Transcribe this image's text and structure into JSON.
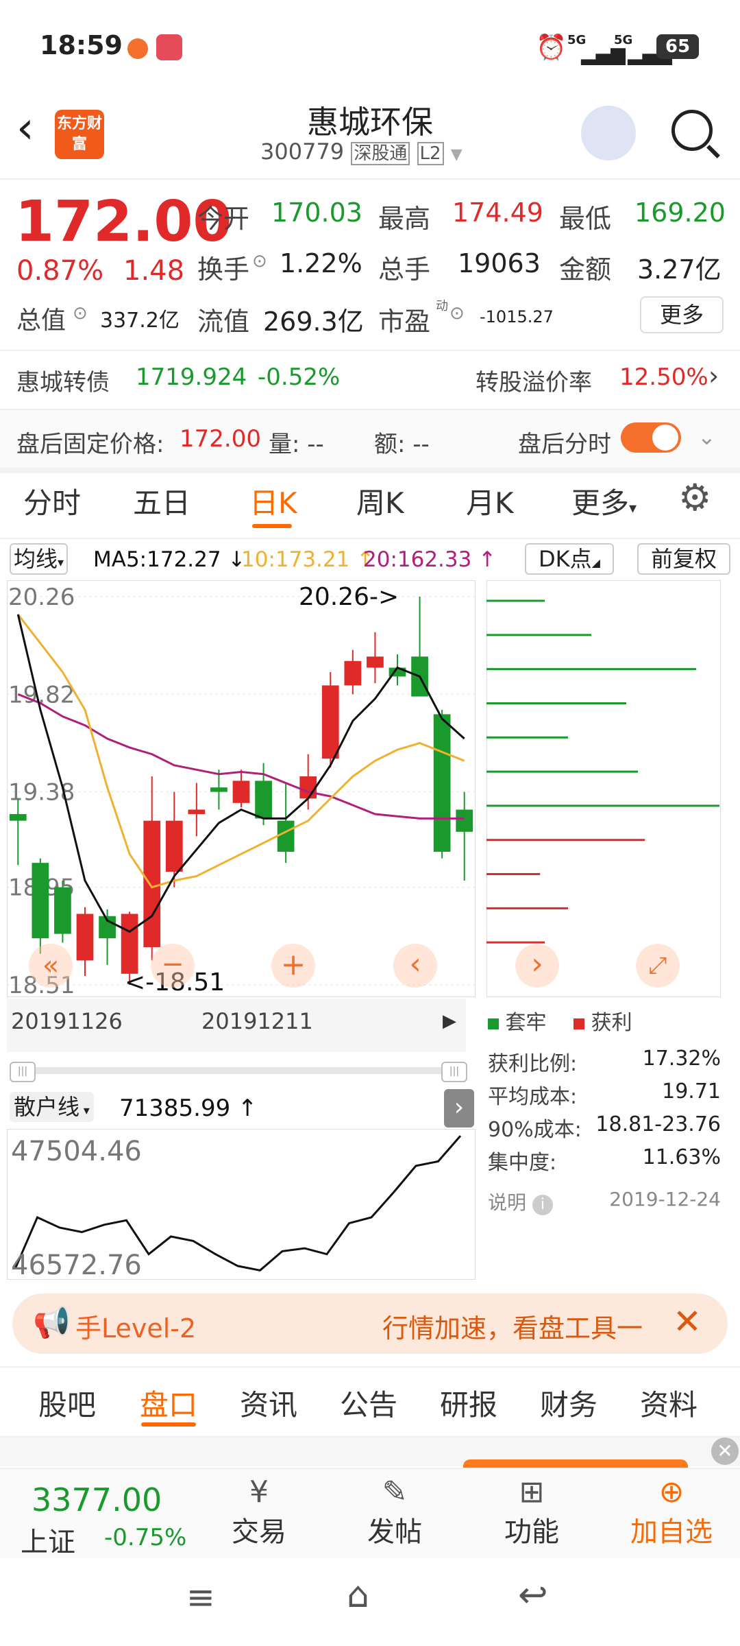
{
  "status_bar": {
    "time": "18:59",
    "net1": "5G",
    "net2": "5G",
    "battery": "65"
  },
  "header": {
    "title": "惠城环保",
    "code": "300779",
    "market_tag": "深股通",
    "level_tag": "L2",
    "logo_text": "东方财富"
  },
  "quote": {
    "price": "172.00",
    "change_pct": "0.87%",
    "change_amt": "1.48",
    "open_label": "今开",
    "open": "170.03",
    "high_label": "最高",
    "high": "174.49",
    "low_label": "最低",
    "low": "169.20",
    "turnover_label": "换手",
    "turnover": "1.22%",
    "volume_label": "总手",
    "volume": "19063",
    "amount_label": "金额",
    "amount": "3.27亿",
    "mktcap_label": "总值",
    "mktcap": "337.2亿",
    "float_label": "流值",
    "float": "269.3亿",
    "pe_label": "市盈",
    "pe_sup": "动",
    "pe": "-1015.27",
    "more_label": "更多"
  },
  "bond": {
    "name": "惠城转债",
    "price": "1719.924",
    "change": "-0.52%",
    "premium_label": "转股溢价率",
    "premium": "12.50%"
  },
  "after": {
    "fixed_label": "盘后固定价格:",
    "fixed_price": "172.00",
    "vol_label": "量: --",
    "amt_label": "额: --",
    "toggle_label": "盘后分时"
  },
  "tabs": [
    "分时",
    "五日",
    "日K",
    "周K",
    "月K",
    "更多"
  ],
  "ma": {
    "selector": "均线",
    "ma5": "MA5:172.27 ↓",
    "ma10": "10:173.21 ↑",
    "ma20": "20:162.33 ↑",
    "dk": "DK点",
    "adjust": "前复权"
  },
  "chart_labels": {
    "max_note": "20.26->",
    "min_note": "<-18.51",
    "date_start": "20191126",
    "date_mid": "20191211"
  },
  "chip_legend": {
    "lock_label": "套牢",
    "profit_label": "获利"
  },
  "chip_stats": [
    {
      "label": "获利比例:",
      "value": "17.32%"
    },
    {
      "label": "平均成本:",
      "value": "19.71"
    },
    {
      "label": "90%成本:",
      "value": "18.81-23.76"
    },
    {
      "label": "集中度:",
      "value": "11.63%"
    }
  ],
  "chip_note": {
    "label": "说明",
    "date": "2019-12-24"
  },
  "retail": {
    "selector": "散户线",
    "value": "71385.99 ↑",
    "max": "47504.46",
    "min": "46572.76"
  },
  "banner": {
    "left": "手Level-2",
    "right": "行情加速，看盘工具一"
  },
  "subtabs": [
    "股吧",
    "盘口",
    "资讯",
    "公告",
    "研报",
    "财务",
    "资料"
  ],
  "bottom_bar": {
    "index_value": "3377.00",
    "index_name": "上证",
    "index_change": "-0.75%",
    "trade": "交易",
    "post": "发帖",
    "func": "功能",
    "add": "加自选"
  },
  "colors": {
    "up": "#e02a2a",
    "down": "#1a9a2c",
    "accent": "#ff6a00",
    "ma5": "#111111",
    "ma10": "#f0b030",
    "ma20": "#b0207a"
  },
  "chart_data": {
    "type": "candlestick",
    "y_ticks": [
      "20.26",
      "19.82",
      "19.38",
      "18.95",
      "18.51"
    ],
    "ylim": [
      18.51,
      20.26
    ],
    "candles": [
      {
        "o": 19.28,
        "c": 19.25,
        "h": 19.35,
        "l": 19.05
      },
      {
        "o": 19.06,
        "c": 18.72,
        "h": 19.08,
        "l": 18.65
      },
      {
        "o": 18.95,
        "c": 18.74,
        "h": 18.98,
        "l": 18.7
      },
      {
        "o": 18.62,
        "c": 18.83,
        "h": 18.86,
        "l": 18.55
      },
      {
        "o": 18.82,
        "c": 18.72,
        "h": 18.85,
        "l": 18.6
      },
      {
        "o": 18.56,
        "c": 18.83,
        "h": 18.84,
        "l": 18.51
      },
      {
        "o": 18.68,
        "c": 19.25,
        "h": 19.45,
        "l": 18.62
      },
      {
        "o": 19.02,
        "c": 19.25,
        "h": 19.38,
        "l": 18.95
      },
      {
        "o": 19.28,
        "c": 19.3,
        "h": 19.42,
        "l": 19.18
      },
      {
        "o": 19.4,
        "c": 19.38,
        "h": 19.48,
        "l": 19.3
      },
      {
        "o": 19.33,
        "c": 19.43,
        "h": 19.48,
        "l": 19.31
      },
      {
        "o": 19.43,
        "c": 19.26,
        "h": 19.51,
        "l": 19.23
      },
      {
        "o": 19.25,
        "c": 19.11,
        "h": 19.42,
        "l": 19.06
      },
      {
        "o": 19.35,
        "c": 19.45,
        "h": 19.55,
        "l": 19.3
      },
      {
        "o": 19.53,
        "c": 19.86,
        "h": 19.92,
        "l": 19.49
      },
      {
        "o": 19.86,
        "c": 19.97,
        "h": 20.02,
        "l": 19.82
      },
      {
        "o": 19.94,
        "c": 19.99,
        "h": 20.1,
        "l": 19.87
      },
      {
        "o": 19.94,
        "c": 19.9,
        "h": 20.0,
        "l": 19.86
      },
      {
        "o": 19.99,
        "c": 19.81,
        "h": 20.26,
        "l": 19.84
      },
      {
        "o": 19.73,
        "c": 19.11,
        "h": 19.75,
        "l": 19.08
      },
      {
        "o": 19.3,
        "c": 19.2,
        "h": 19.38,
        "l": 18.98
      }
    ],
    "ma5": [
      20.18,
      19.75,
      19.4,
      18.98,
      18.8,
      18.75,
      18.82,
      19.0,
      19.12,
      19.24,
      19.3,
      19.26,
      19.26,
      19.35,
      19.5,
      19.7,
      19.8,
      19.94,
      19.9,
      19.71,
      19.62
    ],
    "ma10": [
      20.18,
      20.05,
      19.92,
      19.75,
      19.4,
      19.1,
      18.95,
      18.98,
      19.0,
      19.05,
      19.1,
      19.15,
      19.2,
      19.25,
      19.35,
      19.45,
      19.52,
      19.57,
      19.6,
      19.56,
      19.52
    ],
    "ma20": [
      19.82,
      19.78,
      19.72,
      19.68,
      19.62,
      19.58,
      19.55,
      19.5,
      19.48,
      19.46,
      19.47,
      19.46,
      19.42,
      19.38,
      19.36,
      19.32,
      19.28,
      19.27,
      19.26,
      19.26,
      19.26
    ],
    "chip_bars": [
      {
        "w": 0.25,
        "t": "lock"
      },
      {
        "w": 0.45,
        "t": "lock"
      },
      {
        "w": 0.9,
        "t": "lock"
      },
      {
        "w": 0.6,
        "t": "lock"
      },
      {
        "w": 0.35,
        "t": "lock"
      },
      {
        "w": 0.65,
        "t": "lock"
      },
      {
        "w": 1.0,
        "t": "lock"
      },
      {
        "w": 0.68,
        "t": "profit"
      },
      {
        "w": 0.23,
        "t": "profit"
      },
      {
        "w": 0.35,
        "t": "profit"
      },
      {
        "w": 0.25,
        "t": "profit"
      }
    ],
    "retail_line": [
      46600,
      46950,
      46880,
      46850,
      46900,
      46930,
      46700,
      46820,
      46790,
      46700,
      46620,
      46590,
      46720,
      46740,
      46700,
      46910,
      46950,
      47120,
      47300,
      47330,
      47504
    ]
  }
}
